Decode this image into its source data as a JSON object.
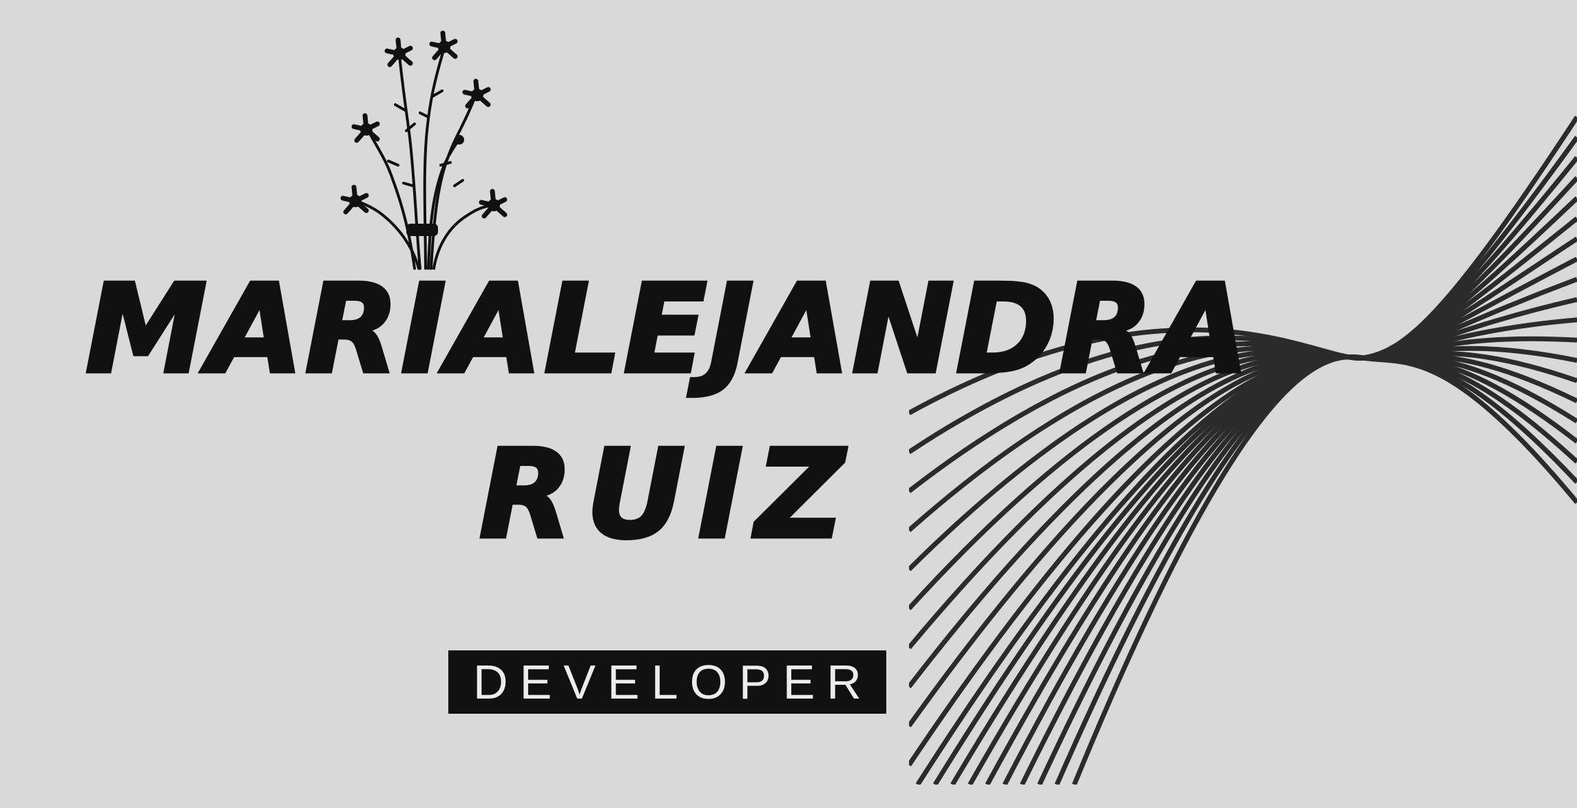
{
  "colors": {
    "background": "#d9d9d9",
    "ink": "#111111",
    "lines": "#2b2b2b",
    "role_text": "#ececec"
  },
  "icons": {
    "flower": "flower-bouquet-icon",
    "lines": "wave-lines-graphic"
  },
  "name": {
    "line1": "MARIALEJANDRA",
    "line2": "RUIZ"
  },
  "role": {
    "label": "DEVELOPER"
  }
}
